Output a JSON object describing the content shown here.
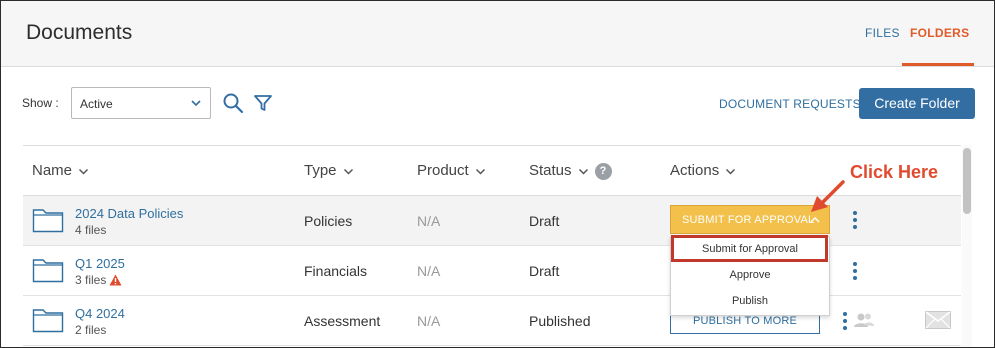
{
  "header": {
    "title": "Documents",
    "tabs": [
      {
        "label": "FILES",
        "active": false
      },
      {
        "label": "FOLDERS",
        "active": true
      }
    ]
  },
  "toolbar": {
    "show_label": "Show :",
    "status_filter": {
      "selected": "Active"
    },
    "search_icon": "search-icon",
    "filter_icon": "filter-icon",
    "document_requests_label": "DOCUMENT REQUESTS",
    "create_folder_label": "Create Folder"
  },
  "table": {
    "columns": [
      "Name",
      "Type",
      "Product",
      "Status",
      "Actions"
    ],
    "status_help": "?",
    "rows": [
      {
        "name": "2024 Data Policies",
        "files": "4 files",
        "type": "Policies",
        "product": "N/A",
        "status": "Draft",
        "action": "SUBMIT FOR APPROVAL"
      },
      {
        "name": "Q1 2025",
        "files": "3 files",
        "type": "Financials",
        "product": "N/A",
        "status": "Draft",
        "action": ""
      },
      {
        "name": "Q4 2024",
        "files": "2 files",
        "type": "Assessment",
        "product": "N/A",
        "status": "Published",
        "action": "PUBLISH TO MORE"
      }
    ]
  },
  "action_menu": {
    "items": [
      "Submit for Approval",
      "Approve",
      "Publish"
    ],
    "highlighted": "Submit for Approval"
  },
  "annotation": {
    "text": "Click Here",
    "color": "#e04a2f"
  },
  "colors": {
    "accent_blue": "#336ea3",
    "active_tab": "#e15b2a",
    "action_button": "#f2c04b",
    "warning": "#e04a2f"
  }
}
